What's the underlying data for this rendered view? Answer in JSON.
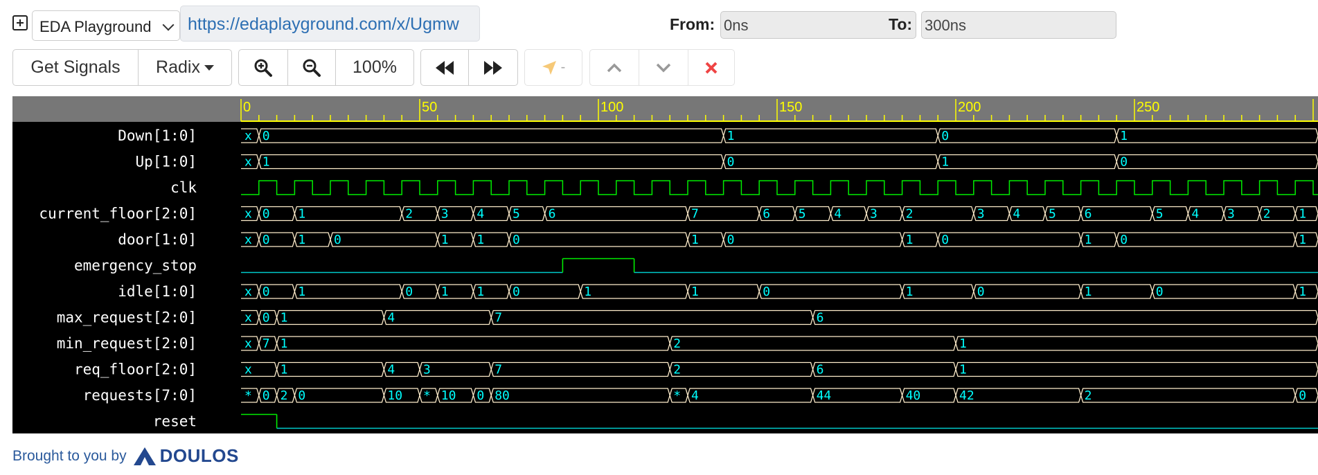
{
  "header": {
    "site_name": "EDA Playground",
    "url": "https://edaplayground.com/x/Ugmw",
    "from_label": "From:",
    "from_value": "0ns",
    "to_label": "To:",
    "to_value": "300ns"
  },
  "toolbar": {
    "get_signals": "Get Signals",
    "radix": "Radix",
    "zoom_level": "100%",
    "marker_label": "-"
  },
  "ruler": {
    "labels": [
      "0",
      "50",
      "100",
      "150",
      "200",
      "250"
    ]
  },
  "waveform": {
    "time_range": [
      0,
      300
    ],
    "signals": [
      {
        "name": "Down[1:0]",
        "type": "bus",
        "segments": [
          [
            0,
            "x"
          ],
          [
            5,
            "0"
          ],
          [
            135,
            "1"
          ],
          [
            195,
            "0"
          ],
          [
            245,
            "1"
          ]
        ]
      },
      {
        "name": "Up[1:0]",
        "type": "bus",
        "segments": [
          [
            0,
            "x"
          ],
          [
            5,
            "1"
          ],
          [
            135,
            "0"
          ],
          [
            195,
            "1"
          ],
          [
            245,
            "0"
          ]
        ]
      },
      {
        "name": "clk",
        "type": "clock",
        "period": 10,
        "start": 5
      },
      {
        "name": "current_floor[2:0]",
        "type": "bus",
        "segments": [
          [
            0,
            "x"
          ],
          [
            5,
            "0"
          ],
          [
            15,
            "1"
          ],
          [
            45,
            "2"
          ],
          [
            55,
            "3"
          ],
          [
            65,
            "4"
          ],
          [
            75,
            "5"
          ],
          [
            85,
            "6"
          ],
          [
            125,
            "7"
          ],
          [
            145,
            "6"
          ],
          [
            155,
            "5"
          ],
          [
            165,
            "4"
          ],
          [
            175,
            "3"
          ],
          [
            185,
            "2"
          ],
          [
            205,
            "3"
          ],
          [
            215,
            "4"
          ],
          [
            225,
            "5"
          ],
          [
            235,
            "6"
          ],
          [
            255,
            "5"
          ],
          [
            265,
            "4"
          ],
          [
            275,
            "3"
          ],
          [
            285,
            "2"
          ],
          [
            295,
            "1"
          ]
        ]
      },
      {
        "name": "door[1:0]",
        "type": "bus",
        "segments": [
          [
            0,
            "x"
          ],
          [
            5,
            "0"
          ],
          [
            15,
            "1"
          ],
          [
            25,
            "0"
          ],
          [
            55,
            "1"
          ],
          [
            65,
            "1"
          ],
          [
            75,
            "0"
          ],
          [
            125,
            "1"
          ],
          [
            135,
            "0"
          ],
          [
            185,
            "1"
          ],
          [
            195,
            "0"
          ],
          [
            235,
            "1"
          ],
          [
            245,
            "0"
          ],
          [
            295,
            "1"
          ]
        ]
      },
      {
        "name": "emergency_stop",
        "type": "bit",
        "transitions": [
          [
            0,
            0
          ],
          [
            90,
            1
          ],
          [
            110,
            0
          ]
        ]
      },
      {
        "name": "idle[1:0]",
        "type": "bus",
        "segments": [
          [
            0,
            "x"
          ],
          [
            5,
            "0"
          ],
          [
            15,
            "1"
          ],
          [
            45,
            "0"
          ],
          [
            55,
            "1"
          ],
          [
            65,
            "1"
          ],
          [
            75,
            "0"
          ],
          [
            95,
            "1"
          ],
          [
            125,
            "1"
          ],
          [
            145,
            "0"
          ],
          [
            185,
            "1"
          ],
          [
            205,
            "0"
          ],
          [
            235,
            "1"
          ],
          [
            255,
            "0"
          ],
          [
            295,
            "1"
          ]
        ]
      },
      {
        "name": "max_request[2:0]",
        "type": "bus",
        "segments": [
          [
            0,
            "x"
          ],
          [
            5,
            "0"
          ],
          [
            10,
            "1"
          ],
          [
            40,
            "4"
          ],
          [
            70,
            "7"
          ],
          [
            160,
            "6"
          ]
        ]
      },
      {
        "name": "min_request[2:0]",
        "type": "bus",
        "segments": [
          [
            0,
            "x"
          ],
          [
            5,
            "7"
          ],
          [
            10,
            "1"
          ],
          [
            120,
            "2"
          ],
          [
            200,
            "1"
          ]
        ]
      },
      {
        "name": "req_floor[2:0]",
        "type": "bus",
        "segments": [
          [
            0,
            "x"
          ],
          [
            10,
            "1"
          ],
          [
            40,
            "4"
          ],
          [
            50,
            "3"
          ],
          [
            70,
            "7"
          ],
          [
            120,
            "2"
          ],
          [
            160,
            "6"
          ],
          [
            200,
            "1"
          ]
        ]
      },
      {
        "name": "requests[7:0]",
        "type": "bus",
        "segments": [
          [
            0,
            "*"
          ],
          [
            5,
            "0"
          ],
          [
            10,
            "2"
          ],
          [
            15,
            "0"
          ],
          [
            40,
            "10"
          ],
          [
            50,
            "*"
          ],
          [
            55,
            "10"
          ],
          [
            65,
            "0"
          ],
          [
            70,
            "80"
          ],
          [
            120,
            "*"
          ],
          [
            125,
            "4"
          ],
          [
            160,
            "44"
          ],
          [
            185,
            "40"
          ],
          [
            200,
            "42"
          ],
          [
            235,
            "2"
          ],
          [
            295,
            "0"
          ]
        ]
      },
      {
        "name": "reset",
        "type": "bit",
        "transitions": [
          [
            0,
            1
          ],
          [
            10,
            0
          ]
        ]
      }
    ]
  },
  "footer": {
    "text": "Brought to you by",
    "brand": "DOULOS"
  },
  "colors": {
    "ruler_bg": "#777777",
    "wave_bg": "#000000",
    "bus_line": "#ffeecc",
    "value_text": "#00ffff",
    "bit_high": "#00ee00",
    "bit_low": "#00cccc",
    "ruler_text": "#ffff00",
    "stop_icon": "#ef4444"
  }
}
